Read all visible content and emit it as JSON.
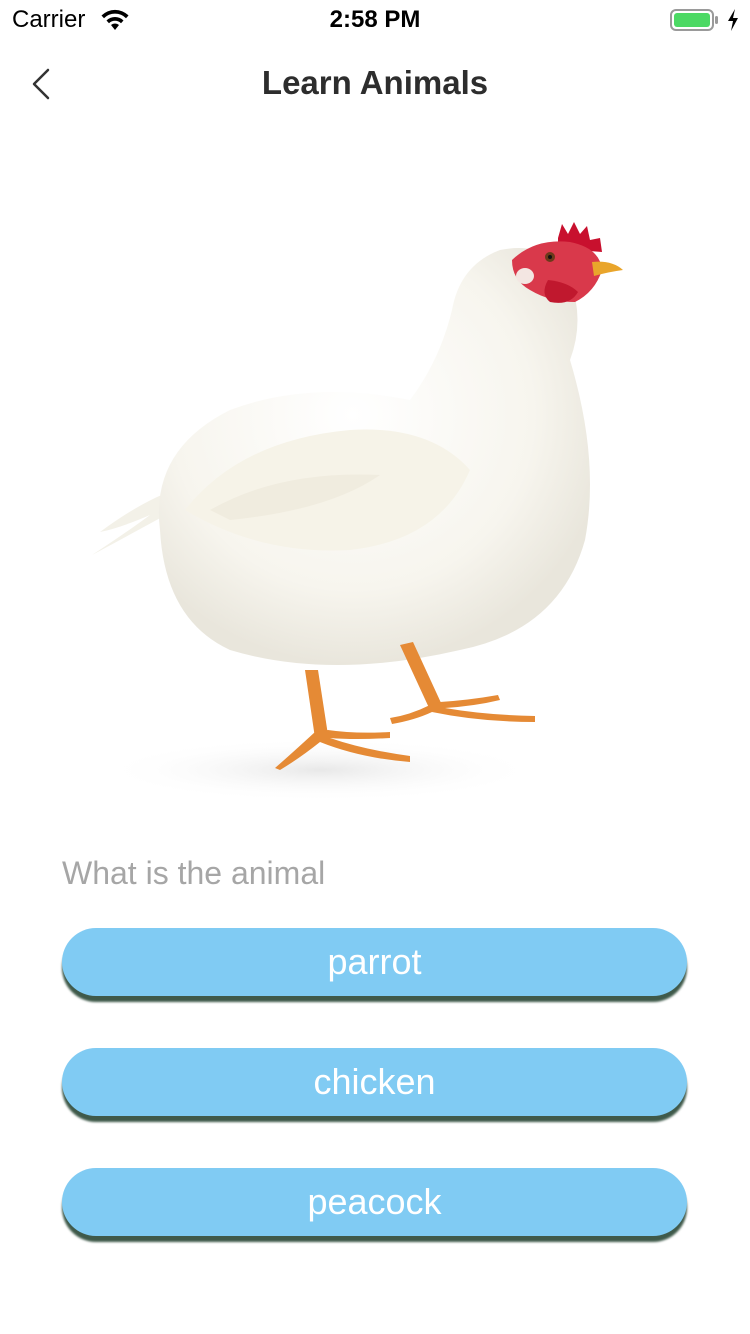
{
  "status_bar": {
    "carrier": "Carrier",
    "time": "2:58 PM",
    "battery_color": "#4cd964"
  },
  "nav": {
    "title": "Learn Animals",
    "back_icon": "chevron-left-icon"
  },
  "quiz": {
    "image_subject": "white-chicken",
    "question": "What is the animal",
    "options": [
      {
        "label": "parrot"
      },
      {
        "label": "chicken"
      },
      {
        "label": "peacock"
      }
    ],
    "button_color": "#80cbf3"
  }
}
